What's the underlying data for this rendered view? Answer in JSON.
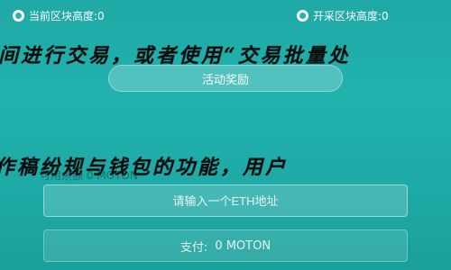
{
  "header": {
    "left_stat": "当前区块高度:0",
    "right_stat": "开采区块高度:0"
  },
  "overlays": {
    "line1": "间进行交易，或者使用“交易批量处",
    "line2": "作稿纷规与钱包的功能，用户"
  },
  "activity": {
    "label": "活动奖励"
  },
  "mid_label": "可用余额 0 MOTON",
  "eth_input": {
    "placeholder": "请输入一个ETH地址",
    "value": ""
  },
  "pay": {
    "label": "支付:",
    "amount": "0 MOTON"
  }
}
